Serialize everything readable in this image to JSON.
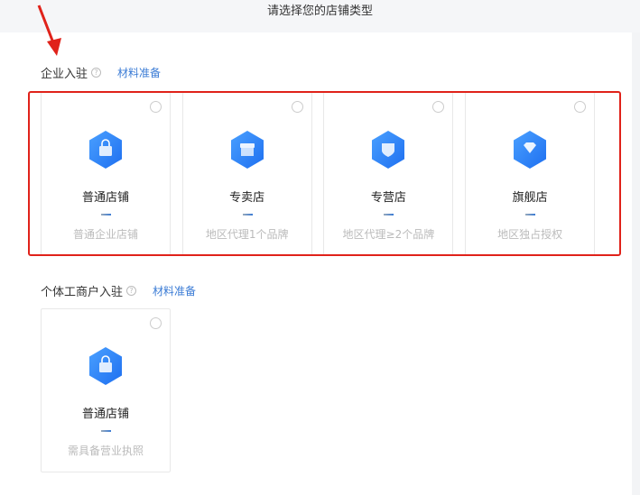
{
  "header": {
    "title": "请选择您的店铺类型"
  },
  "sections": [
    {
      "label": "企业入驻",
      "help": "?",
      "link": "材料准备",
      "cards": [
        {
          "name": "普通店铺",
          "desc": "普通企业店铺",
          "icon": "bag-icon"
        },
        {
          "name": "专卖店",
          "desc": "地区代理1个品牌",
          "icon": "store-icon"
        },
        {
          "name": "专营店",
          "desc": "地区代理≥2个品牌",
          "icon": "shield-icon"
        },
        {
          "name": "旗舰店",
          "desc": "地区独占授权",
          "icon": "diamond-icon"
        }
      ]
    },
    {
      "label": "个体工商户入驻",
      "help": "?",
      "link": "材料准备",
      "cards": [
        {
          "name": "普通店铺",
          "desc": "需具备营业执照",
          "icon": "bag-icon"
        }
      ]
    }
  ],
  "colors": {
    "accent": "#3a7bd5",
    "highlight": "#e0221a",
    "icon_start": "#4aa0ff",
    "icon_end": "#1e6ff0"
  }
}
